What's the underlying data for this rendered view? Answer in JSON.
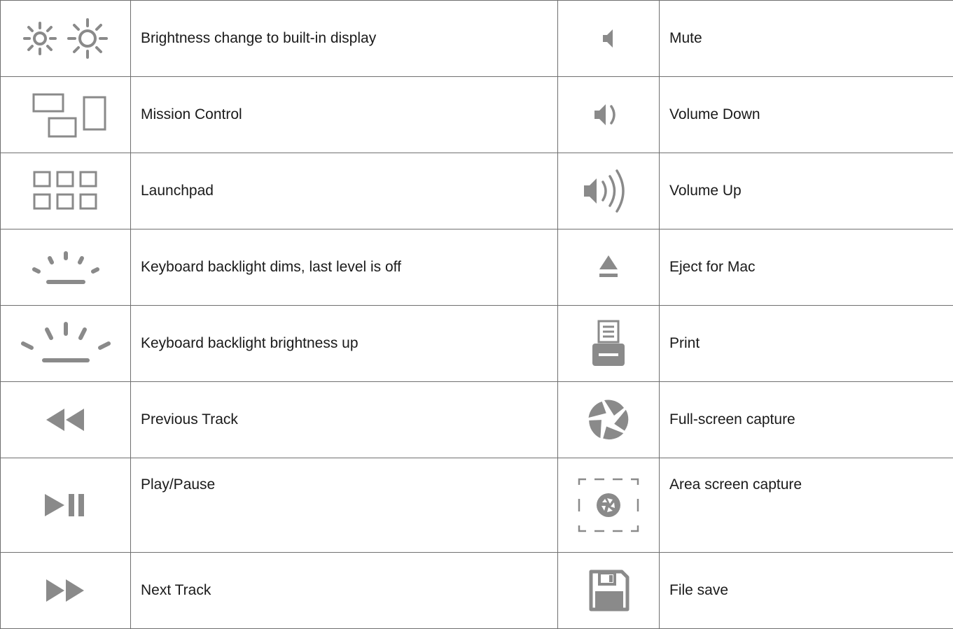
{
  "icon_color": "#8a8a8a",
  "border_color": "#6f6f6f",
  "rows": [
    {
      "left_icon": "brightness-icon",
      "left_label": "Brightness change to built-in display",
      "right_icon": "mute-icon",
      "right_label": "Mute"
    },
    {
      "left_icon": "mission-control-icon",
      "left_label": "Mission Control",
      "right_icon": "volume-down-icon",
      "right_label": "Volume Down"
    },
    {
      "left_icon": "launchpad-icon",
      "left_label": "Launchpad",
      "right_icon": "volume-up-icon",
      "right_label": "Volume Up"
    },
    {
      "left_icon": "backlight-dim-icon",
      "left_label": "Keyboard backlight dims, last level is off",
      "right_icon": "eject-icon",
      "right_label": "Eject for Mac"
    },
    {
      "left_icon": "backlight-up-icon",
      "left_label": "Keyboard backlight brightness up",
      "right_icon": "print-icon",
      "right_label": "Print"
    },
    {
      "left_icon": "previous-track-icon",
      "left_label": "Previous Track",
      "right_icon": "full-screen-capture-icon",
      "right_label": "Full-screen capture"
    },
    {
      "left_icon": "play-pause-icon",
      "left_label": "Play/Pause",
      "right_icon": "area-screen-capture-icon",
      "right_label": "Area screen capture"
    },
    {
      "left_icon": "next-track-icon",
      "left_label": "Next Track",
      "right_icon": "file-save-icon",
      "right_label": "File save"
    }
  ]
}
